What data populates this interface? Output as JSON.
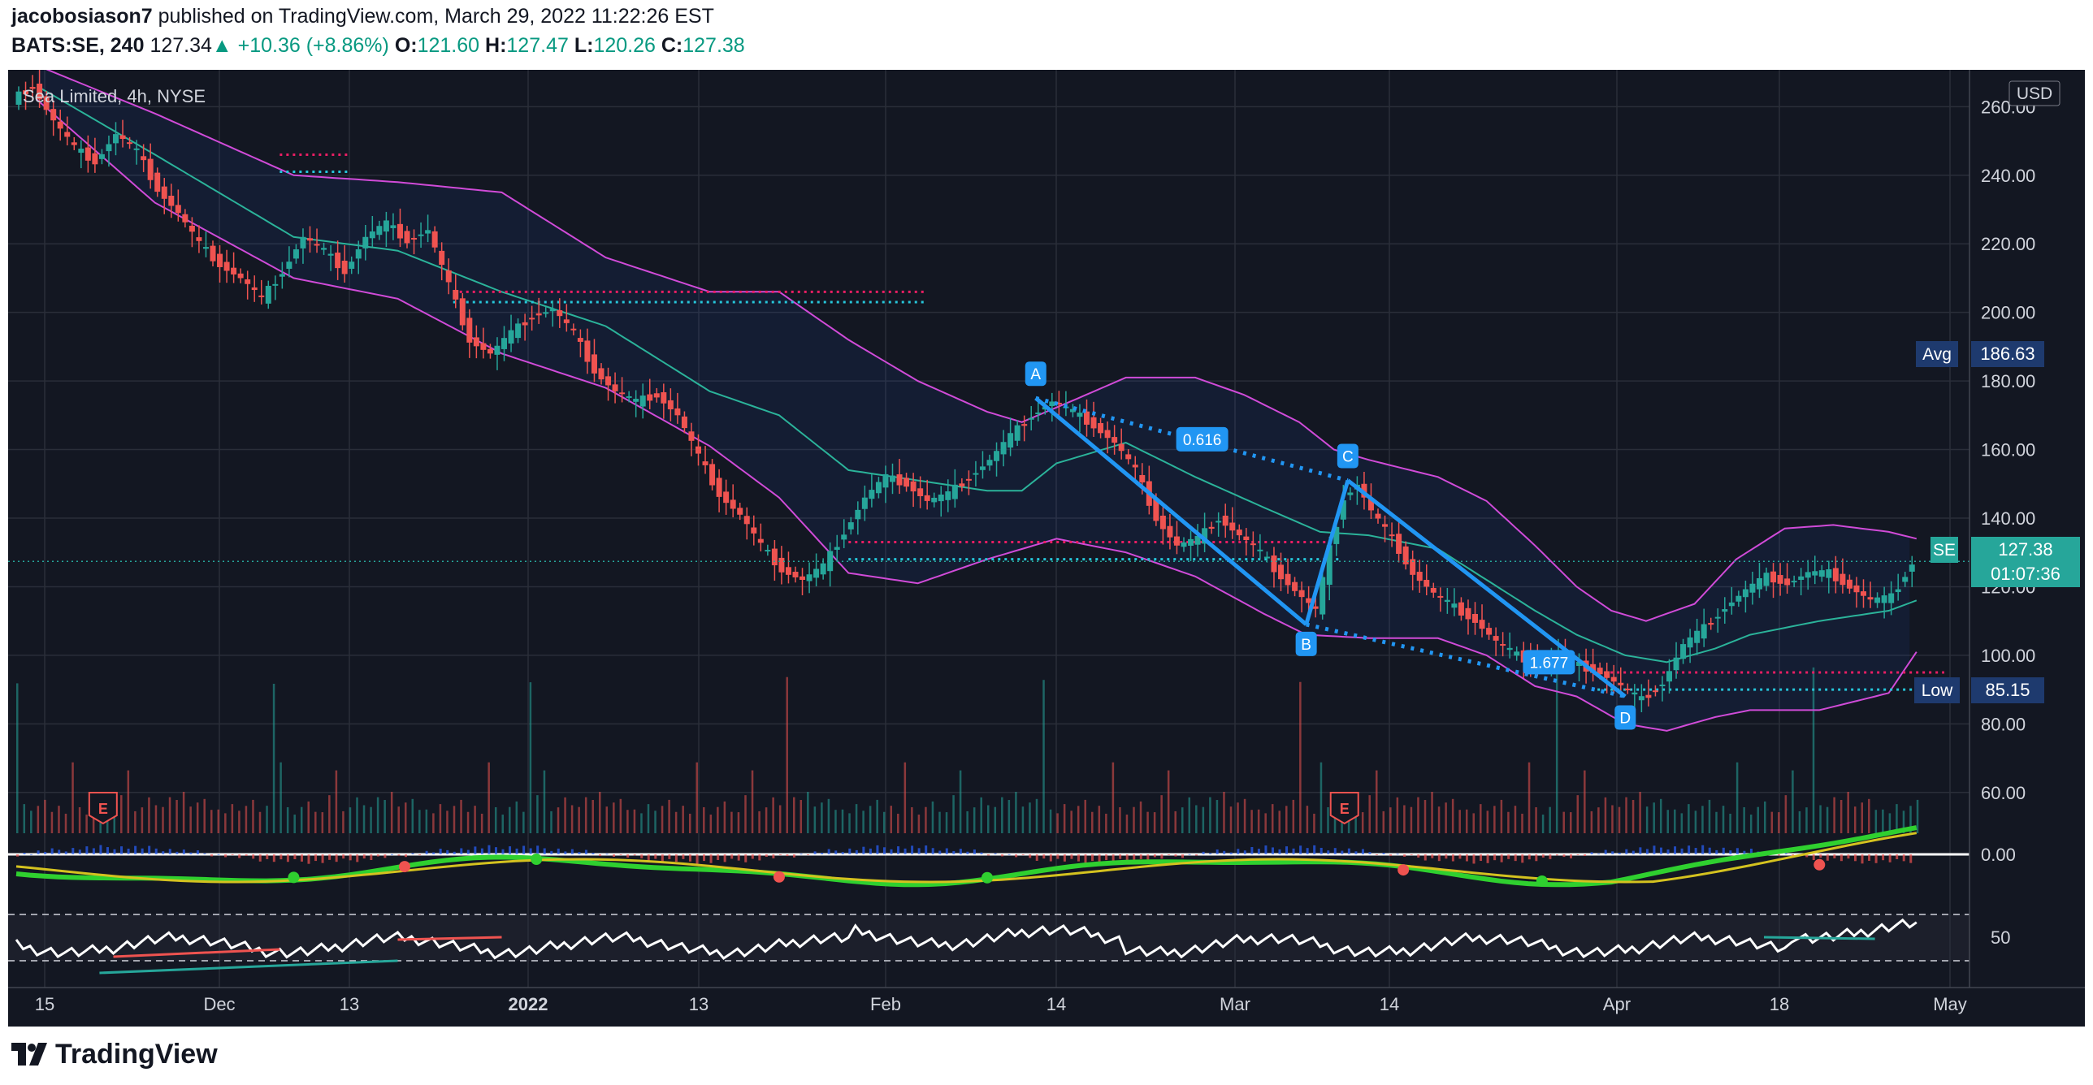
{
  "header": {
    "author": "jacobosiason7",
    "published_text": "published on TradingView.com, March 29, 2022 11:22:26 EST",
    "symbol": "BATS:SE, 240",
    "last": "127.34",
    "arrow": "▲",
    "change": "+10.36 (+8.86%)",
    "o_label": "O:",
    "o": "121.60",
    "h_label": "H:",
    "h": "127.47",
    "l_label": "L:",
    "l": "120.26",
    "c_label": "C:",
    "c": "127.38"
  },
  "legend": {
    "title": "Sea Limited, 4h, NYSE"
  },
  "currency": "USD",
  "price_badges": {
    "avg_label": "Avg",
    "avg_value": "186.63",
    "low_label": "Low",
    "low_value": "85.15",
    "sym_label": "SE",
    "sym_price": "127.38",
    "countdown": "01:07:36"
  },
  "pattern_labels": {
    "A": "A",
    "B": "B",
    "C": "C",
    "D": "D",
    "ratio1": "0.616",
    "ratio2": "1.677"
  },
  "earnings_marker": "E",
  "brand": "TradingView",
  "colors": {
    "bg": "#131722",
    "up": "#26a69a",
    "down": "#ef5350",
    "bb": "#d04bd8",
    "basis": "#2bb39a",
    "pattern": "#2196f3",
    "dash_red": "#e91e63",
    "dash_green": "#26c6da"
  },
  "chart_data": {
    "type": "candlestick",
    "title": "Sea Limited, 4h, NYSE",
    "ylim": [
      50,
      266
    ],
    "y_ticks": [
      "260.00",
      "240.00",
      "220.00",
      "200.00",
      "180.00",
      "160.00",
      "140.00",
      "120.00",
      "100.00",
      "80.00",
      "60.00"
    ],
    "x_ticks": [
      "15",
      "Dec",
      "13",
      "2022",
      "13",
      "Feb",
      "14",
      "Mar",
      "14",
      "Apr",
      "18",
      "May"
    ],
    "osc1_ticks": [
      "0.00"
    ],
    "osc2_ticks": [
      "50"
    ],
    "close_path": [
      [
        0,
        262
      ],
      [
        3,
        266
      ],
      [
        6,
        256
      ],
      [
        9,
        248
      ],
      [
        12,
        244
      ],
      [
        15,
        252
      ],
      [
        18,
        247
      ],
      [
        21,
        236
      ],
      [
        24,
        229
      ],
      [
        27,
        220
      ],
      [
        30,
        214
      ],
      [
        33,
        210
      ],
      [
        36,
        204
      ],
      [
        39,
        212
      ],
      [
        42,
        222
      ],
      [
        45,
        218
      ],
      [
        48,
        212
      ],
      [
        51,
        222
      ],
      [
        54,
        226
      ],
      [
        57,
        221
      ],
      [
        60,
        224
      ],
      [
        63,
        208
      ],
      [
        66,
        192
      ],
      [
        69,
        188
      ],
      [
        72,
        194
      ],
      [
        75,
        199
      ],
      [
        78,
        201
      ],
      [
        81,
        194
      ],
      [
        84,
        183
      ],
      [
        87,
        177
      ],
      [
        90,
        174
      ],
      [
        93,
        176
      ],
      [
        96,
        170
      ],
      [
        99,
        158
      ],
      [
        102,
        147
      ],
      [
        105,
        141
      ],
      [
        108,
        132
      ],
      [
        111,
        125
      ],
      [
        114,
        122
      ],
      [
        117,
        126
      ],
      [
        120,
        136
      ],
      [
        123,
        146
      ],
      [
        126,
        152
      ],
      [
        129,
        150
      ],
      [
        132,
        145
      ],
      [
        135,
        147
      ],
      [
        138,
        152
      ],
      [
        141,
        157
      ],
      [
        144,
        164
      ],
      [
        147,
        170
      ],
      [
        150,
        174
      ],
      [
        153,
        171
      ],
      [
        156,
        167
      ],
      [
        159,
        162
      ],
      [
        162,
        154
      ],
      [
        165,
        140
      ],
      [
        168,
        132
      ],
      [
        171,
        134
      ],
      [
        174,
        140
      ],
      [
        177,
        135
      ],
      [
        180,
        130
      ],
      [
        183,
        123
      ],
      [
        186,
        117
      ],
      [
        188,
        113
      ],
      [
        190,
        131
      ],
      [
        192,
        146
      ],
      [
        194,
        150
      ],
      [
        196,
        142
      ],
      [
        199,
        134
      ],
      [
        202,
        124
      ],
      [
        205,
        118
      ],
      [
        208,
        114
      ],
      [
        211,
        110
      ],
      [
        214,
        104
      ],
      [
        217,
        100
      ],
      [
        220,
        97
      ],
      [
        223,
        101
      ],
      [
        226,
        97
      ],
      [
        229,
        95
      ],
      [
        232,
        91
      ],
      [
        235,
        87
      ],
      [
        238,
        92
      ],
      [
        241,
        103
      ],
      [
        244,
        108
      ],
      [
        247,
        114
      ],
      [
        250,
        119
      ],
      [
        253,
        123
      ],
      [
        256,
        121
      ],
      [
        259,
        124
      ],
      [
        262,
        124
      ],
      [
        265,
        120
      ],
      [
        268,
        116
      ],
      [
        271,
        117
      ],
      [
        274,
        127
      ]
    ],
    "bollinger_upper": [
      [
        3,
        272
      ],
      [
        20,
        258
      ],
      [
        40,
        240
      ],
      [
        55,
        238
      ],
      [
        70,
        235
      ],
      [
        85,
        216
      ],
      [
        100,
        206
      ],
      [
        110,
        206
      ],
      [
        120,
        192
      ],
      [
        130,
        180
      ],
      [
        140,
        171
      ],
      [
        145,
        168
      ],
      [
        152,
        174
      ],
      [
        160,
        181
      ],
      [
        170,
        181
      ],
      [
        177,
        176
      ],
      [
        185,
        168
      ],
      [
        190,
        160
      ],
      [
        195,
        157
      ],
      [
        205,
        152
      ],
      [
        212,
        145
      ],
      [
        219,
        132
      ],
      [
        225,
        120
      ],
      [
        230,
        113
      ],
      [
        235,
        110
      ],
      [
        242,
        115
      ],
      [
        248,
        128
      ],
      [
        255,
        137
      ],
      [
        262,
        138
      ],
      [
        270,
        136
      ],
      [
        274,
        134
      ]
    ],
    "bollinger_basis": [
      [
        3,
        266
      ],
      [
        20,
        246
      ],
      [
        40,
        222
      ],
      [
        55,
        218
      ],
      [
        70,
        206
      ],
      [
        85,
        196
      ],
      [
        100,
        177
      ],
      [
        110,
        170
      ],
      [
        120,
        154
      ],
      [
        130,
        151
      ],
      [
        140,
        148
      ],
      [
        145,
        148
      ],
      [
        150,
        156
      ],
      [
        160,
        162
      ],
      [
        170,
        152
      ],
      [
        180,
        143
      ],
      [
        188,
        136
      ],
      [
        195,
        135
      ],
      [
        205,
        131
      ],
      [
        212,
        122
      ],
      [
        219,
        113
      ],
      [
        225,
        106
      ],
      [
        232,
        100
      ],
      [
        238,
        98
      ],
      [
        245,
        102
      ],
      [
        250,
        106
      ],
      [
        260,
        110
      ],
      [
        270,
        113
      ],
      [
        274,
        116
      ]
    ],
    "bollinger_lower": [
      [
        3,
        262
      ],
      [
        20,
        232
      ],
      [
        40,
        210
      ],
      [
        55,
        204
      ],
      [
        70,
        188
      ],
      [
        85,
        178
      ],
      [
        100,
        161
      ],
      [
        110,
        146
      ],
      [
        120,
        124
      ],
      [
        130,
        121
      ],
      [
        140,
        128
      ],
      [
        145,
        131
      ],
      [
        150,
        134
      ],
      [
        160,
        130
      ],
      [
        170,
        123
      ],
      [
        180,
        112
      ],
      [
        186,
        106
      ],
      [
        195,
        105
      ],
      [
        205,
        105
      ],
      [
        212,
        100
      ],
      [
        219,
        91
      ],
      [
        225,
        88
      ],
      [
        232,
        80
      ],
      [
        238,
        78
      ],
      [
        245,
        82
      ],
      [
        250,
        84
      ],
      [
        260,
        84
      ],
      [
        270,
        89
      ],
      [
        274,
        101
      ]
    ],
    "levels": [
      {
        "from": 38,
        "to": 48,
        "y": [
          246,
          241
        ]
      },
      {
        "from": 63,
        "to": 131,
        "y": [
          206,
          203
        ]
      },
      {
        "from": 120,
        "to": 191,
        "y": [
          133,
          128
        ]
      },
      {
        "from": 228,
        "to": 278,
        "y": [
          95,
          90
        ]
      }
    ],
    "pattern": {
      "A": [
        147,
        175
      ],
      "B": [
        186,
        109
      ],
      "C": [
        192,
        151
      ],
      "D": [
        232,
        88
      ],
      "ratio1_at": [
        171,
        163
      ],
      "ratio2_at": [
        221,
        98
      ]
    },
    "pattern_text": [
      "A",
      "B",
      "C",
      "D",
      "0.616",
      "1.677"
    ],
    "volume_levels": [
      0.12,
      0.08,
      0.2,
      0.15,
      0.3,
      0.1,
      0.18,
      0.25,
      0.12,
      0.4,
      0.09,
      0.22,
      0.16,
      0.28,
      0.11,
      0.35,
      0.14,
      0.2,
      0.5,
      0.1,
      0.3,
      0.15,
      0.6,
      0.12,
      0.24,
      0.18,
      0.9,
      0.2,
      0.35,
      0.15
    ],
    "earnings_positions": [
      9,
      188
    ]
  }
}
